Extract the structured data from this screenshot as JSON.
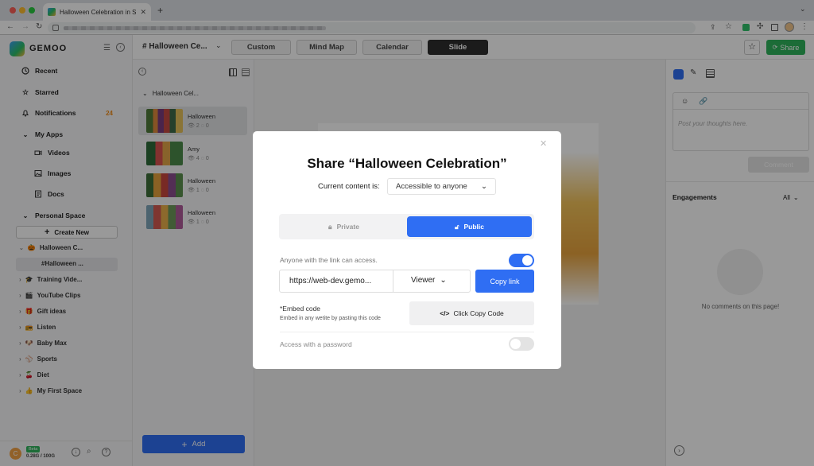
{
  "browser": {
    "tab_title": "Halloween Celebration in Slide"
  },
  "app": {
    "brand": "GEMOO"
  },
  "sidebar": {
    "recent": "Recent",
    "starred": "Starred",
    "notifications": "Notifications",
    "notifications_count": "24",
    "my_apps": "My Apps",
    "videos": "Videos",
    "images": "Images",
    "docs": "Docs",
    "personal_space": "Personal Space",
    "create_new": "Create New",
    "spaces": [
      {
        "emoji": "🎃",
        "label": "Halloween C..."
      },
      {
        "emoji": "",
        "label": "#Halloween ..."
      },
      {
        "emoji": "🎓",
        "label": "Training Vide..."
      },
      {
        "emoji": "🎬",
        "label": "YouTube Clips"
      },
      {
        "emoji": "🎁",
        "label": "Gift ideas"
      },
      {
        "emoji": "📻",
        "label": "Listen"
      },
      {
        "emoji": "🐶",
        "label": "Baby Max"
      },
      {
        "emoji": "⚾",
        "label": "Sports"
      },
      {
        "emoji": "🍒",
        "label": "Diet"
      },
      {
        "emoji": "👍",
        "label": "My First Space"
      }
    ],
    "avatar_letter": "C",
    "plan_badge": "Beta",
    "storage": "0.28G / 100G"
  },
  "topbar": {
    "doc_title": "# Halloween Ce...",
    "tabs": [
      "Custom",
      "Mind Map",
      "Calendar",
      "Slide"
    ],
    "share": "Share"
  },
  "slides_panel": {
    "group": "Halloween Cel...",
    "items": [
      {
        "name": "Halloween",
        "views": "2",
        "comments": "0"
      },
      {
        "name": "Amy",
        "views": "4",
        "comments": "0"
      },
      {
        "name": "Halloween",
        "views": "1",
        "comments": "0"
      },
      {
        "name": "Halloween",
        "views": "1",
        "comments": "0"
      }
    ],
    "add": "Add"
  },
  "right_panel": {
    "placeholder": "Post your thoughts here.",
    "comment_btn": "Comment",
    "engagements": "Engagements",
    "filter": "All",
    "empty": "No comments on this page!"
  },
  "modal": {
    "title": "Share “Halloween Celebration”",
    "content_label": "Current content is:",
    "access_value": "Accessible to anyone",
    "private": "Private",
    "public": "Public",
    "link_access": "Anyone with the link can access.",
    "url": "https://web-dev.gemo...",
    "role": "Viewer",
    "copy_link": "Copy link",
    "embed_title": "*Embed code",
    "embed_desc": "Embed in any wetite by pasting this code",
    "copy_code": "Click Copy Code",
    "password": "Access with a password"
  }
}
